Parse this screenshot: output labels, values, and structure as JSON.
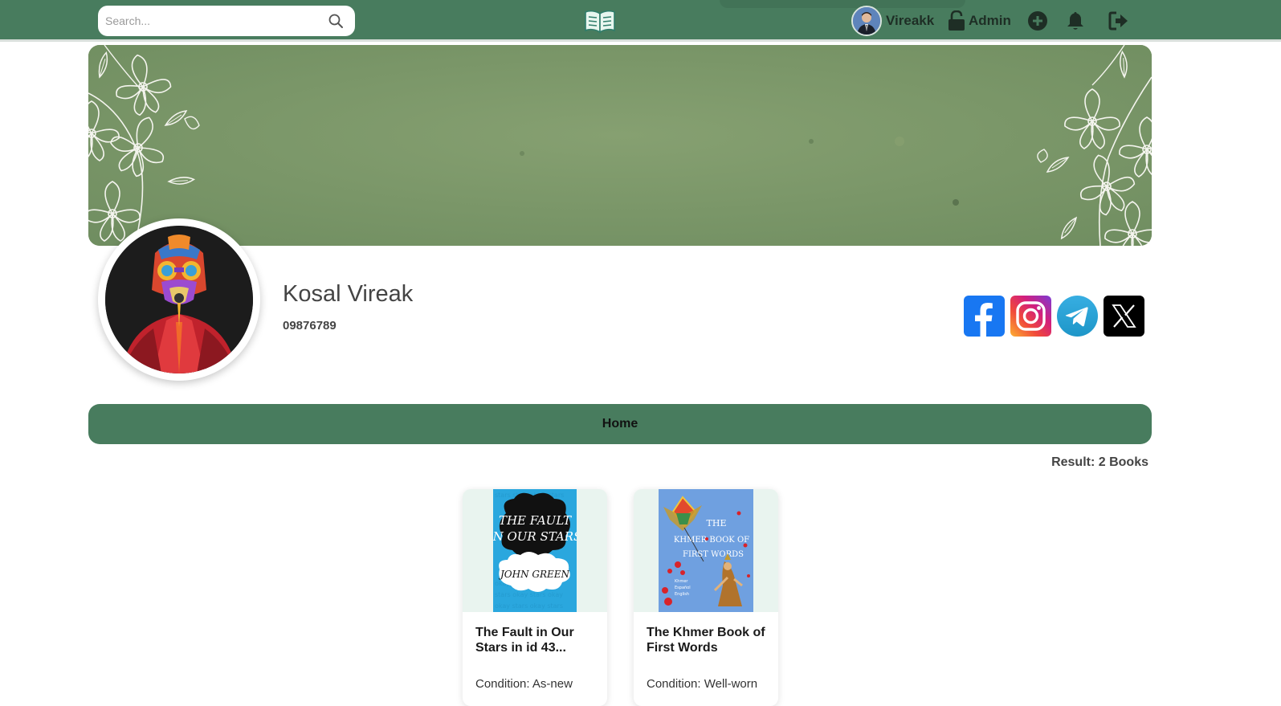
{
  "navbar": {
    "search_placeholder": "Search...",
    "username": "Vireakk",
    "admin_label": "Admin"
  },
  "profile": {
    "name": "Kosal Vireak",
    "phone": "09876789"
  },
  "tabs": {
    "home_label": "Home"
  },
  "result_text": "Result: 2 Books",
  "books": [
    {
      "title": "The Fault in Our Stars in id 43...",
      "condition": "Condition: As-new"
    },
    {
      "title": "The Khmer Book of First Words",
      "condition": "Condition: Well-worn"
    }
  ],
  "icons": {
    "search": "search-icon",
    "logo": "open-book-icon",
    "lock": "lock-icon",
    "add": "plus-circle-icon",
    "bell": "bell-icon",
    "logout": "logout-icon",
    "social": [
      "facebook-icon",
      "instagram-icon",
      "telegram-icon",
      "x-icon"
    ]
  },
  "colors": {
    "brand_green": "#487c5e",
    "cover_green": "#7c9a6a"
  }
}
